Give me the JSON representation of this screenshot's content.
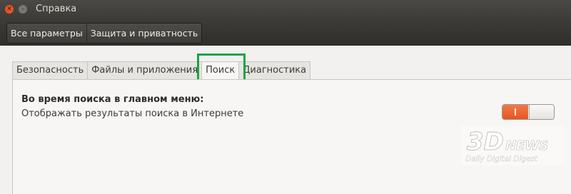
{
  "window": {
    "title": "Справка"
  },
  "toolbar": {
    "breadcrumbs": [
      "Все параметры",
      "Защита и приватность"
    ]
  },
  "tabs": [
    {
      "label": "Безопасность",
      "active": false
    },
    {
      "label": "Файлы и приложения",
      "active": false
    },
    {
      "label": "Поиск",
      "active": true
    },
    {
      "label": "Диагностика",
      "active": false
    }
  ],
  "search_tab": {
    "heading": "Во время поиска в главном меню:",
    "option_label": "Отображать результаты поиска в Интернете",
    "toggle_state": "on"
  },
  "watermark": {
    "logo": "3DNEWS",
    "tagline": "Daily Digital Digest"
  },
  "colors": {
    "accent": "#e95420",
    "highlight_box": "#1aa545"
  }
}
